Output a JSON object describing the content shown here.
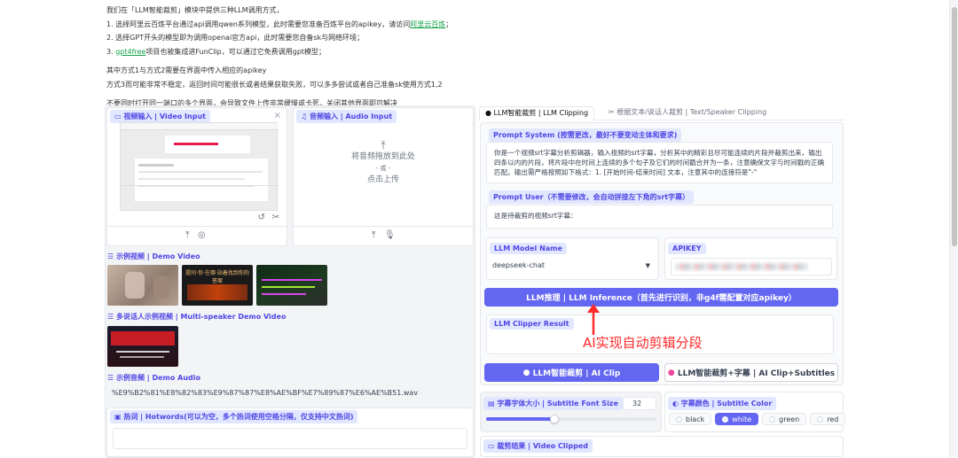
{
  "intro": {
    "line1": "我们在「LLM智能裁剪」模块中提供三种LLM调用方式，",
    "line2_pre": "1. 选择阿里云百炼平台通过api调用qwen系列模型，此时需要您准备百炼平台的apikey，请访问",
    "line2_link": "阿里云百炼",
    "line2_post": "；",
    "line3": "2. 选择GPT开头的模型即为调用openai官方api，此时需要您自备sk与网络环境；",
    "line4_pre": "3. ",
    "line4_link": "gpt4free",
    "line4_post": "项目也被集成进FunClip，可以通过它免费调用gpt模型；",
    "line5": "其中方式1与方式2需要在界面中传入相应的apikey",
    "line6": "方式3而可能非常不稳定，返回时间可能很长或者结果获取失败，可以多多尝试或者自己准备sk使用方式1,2",
    "line7": "不要同时打开同一端口的多个界面，会导致文件上传非常缓慢或卡死，关闭其他界面即可解决"
  },
  "video_input": {
    "label": "视频输入 | Video Input",
    "close": "×"
  },
  "audio_input": {
    "label": "音频输入 | Audio Input",
    "drop_text": "将音频拖放到此处",
    "or": "- 或 -",
    "click_upload": "点击上传"
  },
  "demo_video": {
    "label": "示例视频 | Demo Video",
    "thumb2_text": "提问·你·在哪·站着找到你的答案"
  },
  "multi_speaker": {
    "label": "多说话人示例视频 | Multi-speaker Demo Video"
  },
  "demo_audio": {
    "label": "示例音频 | Demo Audio",
    "filename": "%E9%B2%81%E8%82%83%E9%87%87%E8%AE%BF%E7%89%87%E6%AE%B51.wav"
  },
  "hotwords": {
    "label": "热词 | Hotwords(可以为空，多个热词使用空格分隔，仅支持中文热词)",
    "value": ""
  },
  "tabs": [
    {
      "label": "LLM智能裁剪 | LLM Clipping"
    },
    {
      "label": "根据文本/说话人裁剪 | Text/Speaker Clipping"
    }
  ],
  "prompt_system": {
    "label": "Prompt System (按需更改，最好不要变动主体和要求)",
    "value": "你是一个视频srt字幕分析剪辑器，输入视频的srt字幕，分析其中的精彩且尽可能连续的片段并裁剪出来，输出四条以内的片段，将片段中在时间上连续的多个句子及它们的时间戳合并为一条，注意确保文字与时间戳的正确匹配。输出需严格按照如下格式：1. [开始时间-结束时间] 文本，注意其中的连接符是\"-\""
  },
  "prompt_user": {
    "label": "Prompt User（不需要修改，会自动拼接左下角的srt字幕）",
    "value": "这是待裁剪的视频srt字幕："
  },
  "llm_model": {
    "label": "LLM Model Name",
    "value": "deepseek-chat"
  },
  "apikey": {
    "label": "APIKEY"
  },
  "inference_button": "LLM推理 | LLM Inference（首先进行识别，非g4f需配置对应apikey）",
  "clipper_result": {
    "label": "LLM Clipper Result"
  },
  "annotation": "AI实现自动剪辑分段",
  "ai_clip": "LLM智能裁剪 | AI Clip",
  "ai_clip_sub": "LLM智能裁剪+字幕 | AI Clip+Subtitles",
  "font_size": {
    "label": "字幕字体大小 | Subtitle Font Size",
    "value": "32",
    "fraction": 0.4
  },
  "font_color": {
    "label": "字幕颜色 | Subtitle Color",
    "options": [
      "black",
      "white",
      "green",
      "red"
    ],
    "selected": 1
  },
  "video_clipped": {
    "label": "裁剪结果 | Video Clipped"
  },
  "colors": {
    "accent": "#6366f1",
    "annotation": "#ff2a2a",
    "link": "#16a34a"
  }
}
